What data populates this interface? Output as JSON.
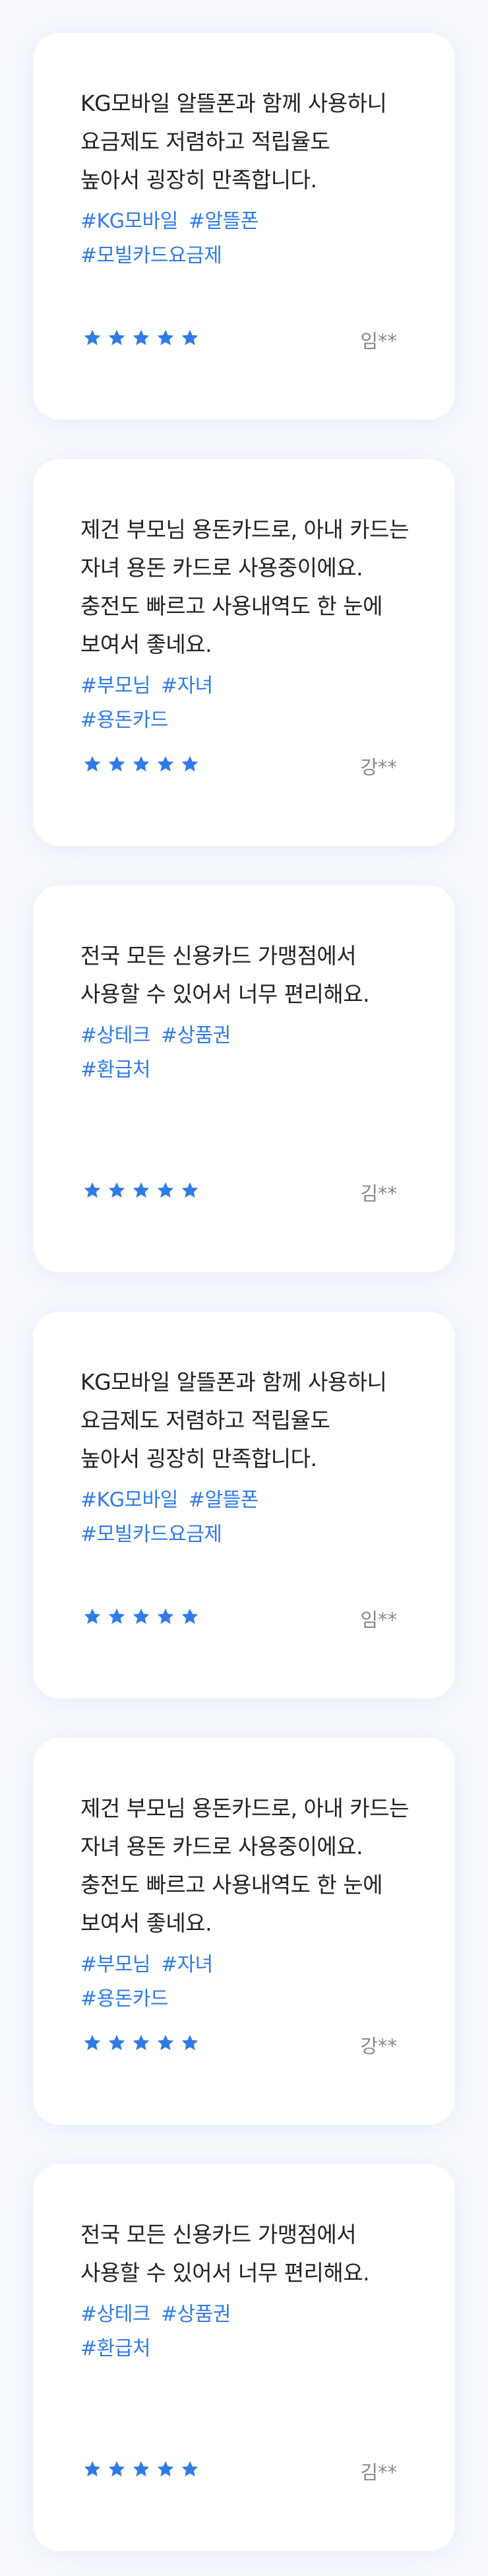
{
  "reviews": [
    {
      "lines": [
        "KG모바일 알뜰폰과 함께 사용하니",
        "요금제도 저렴하고 적립율도",
        "높아서 굉장히 만족합니다."
      ],
      "tags": [
        "#KG모바일",
        "#알뜰폰",
        "#모빌카드요금제"
      ],
      "rating": 5,
      "author": "임**"
    },
    {
      "lines": [
        "제건 부모님 용돈카드로, 아내 카드는",
        "자녀 용돈 카드로 사용중이에요.",
        "충전도 빠르고 사용내역도 한 눈에",
        "보여서 좋네요."
      ],
      "tags": [
        "#부모님",
        "#자녀",
        "#용돈카드"
      ],
      "rating": 5,
      "author": "강**"
    },
    {
      "lines": [
        "전국 모든 신용카드 가맹점에서",
        "사용할 수 있어서 너무 편리해요."
      ],
      "tags": [
        "#상테크",
        "#상품권",
        "#환급처"
      ],
      "rating": 5,
      "author": "김**"
    },
    {
      "lines": [
        "KG모바일 알뜰폰과 함께 사용하니",
        "요금제도 저렴하고 적립율도",
        "높아서 굉장히 만족합니다."
      ],
      "tags": [
        "#KG모바일",
        "#알뜰폰",
        "#모빌카드요금제"
      ],
      "rating": 5,
      "author": "임**"
    },
    {
      "lines": [
        "제건 부모님 용돈카드로, 아내 카드는",
        "자녀 용돈 카드로 사용중이에요.",
        "충전도 빠르고 사용내역도 한 눈에",
        "보여서 좋네요."
      ],
      "tags": [
        "#부모님",
        "#자녀",
        "#용돈카드"
      ],
      "rating": 5,
      "author": "강**"
    },
    {
      "lines": [
        "전국 모든 신용카드 가맹점에서",
        "사용할 수 있어서 너무 편리해요."
      ],
      "tags": [
        "#상테크",
        "#상품권",
        "#환급처"
      ],
      "rating": 5,
      "author": "김**"
    }
  ],
  "colors": {
    "star": "#2f7be8",
    "tag": "#2f7be8",
    "text": "#222222",
    "author": "#888888"
  },
  "icons": {
    "rating": "star-icon"
  }
}
